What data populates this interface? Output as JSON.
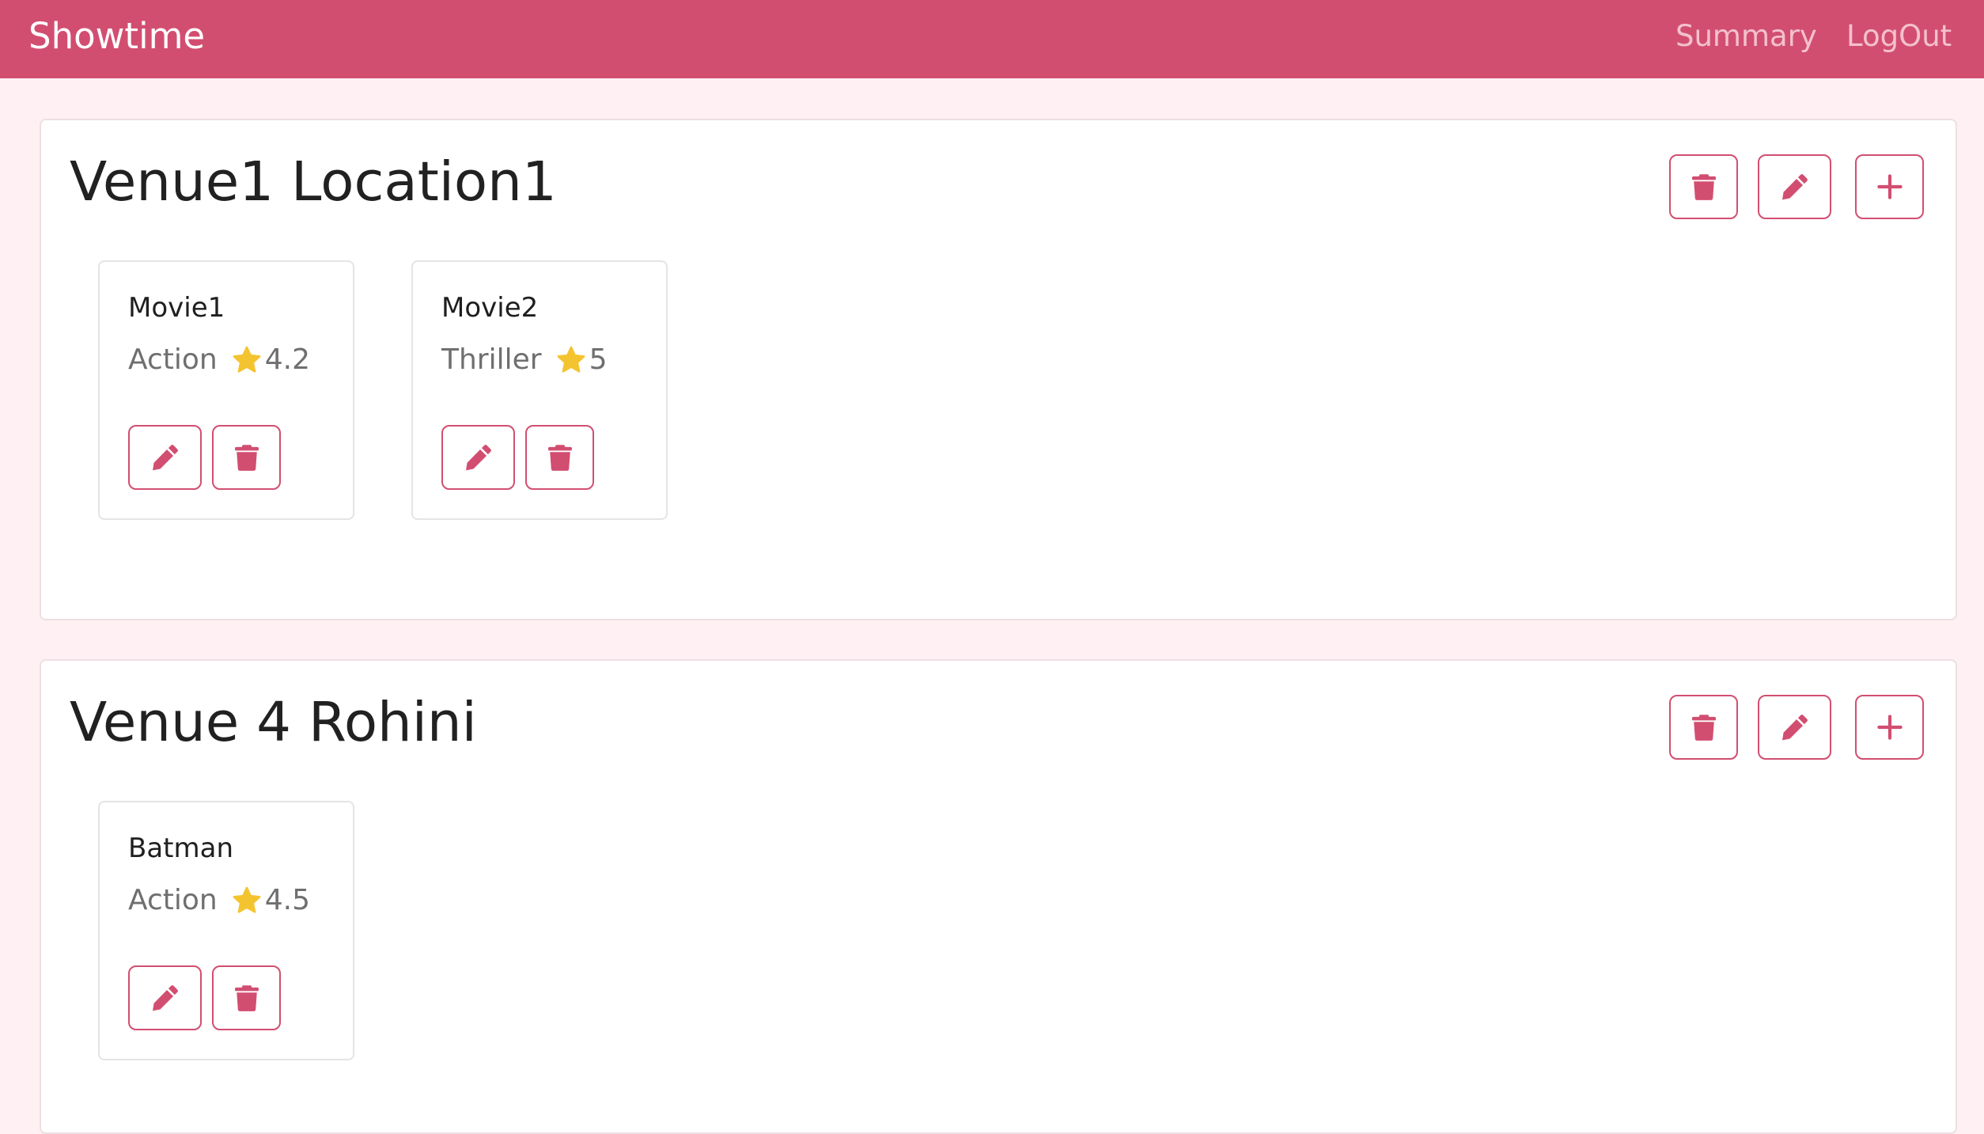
{
  "navbar": {
    "brand": "Showtime",
    "links": [
      "Summary",
      "LogOut"
    ]
  },
  "colors": {
    "accent": "#d24e71",
    "background": "#fff0f3",
    "star": "#f4c430"
  },
  "venues": [
    {
      "title": "Venue1 Location1",
      "actions": [
        "trash-icon",
        "pencil-icon",
        "plus-icon"
      ],
      "movies": [
        {
          "name": "Movie1",
          "genre": "Action",
          "rating": "4.2"
        },
        {
          "name": "Movie2",
          "genre": "Thriller",
          "rating": "5"
        }
      ]
    },
    {
      "title": "Venue 4 Rohini",
      "actions": [
        "trash-icon",
        "pencil-icon",
        "plus-icon"
      ],
      "movies": [
        {
          "name": "Batman",
          "genre": "Action",
          "rating": "4.5"
        }
      ]
    }
  ]
}
